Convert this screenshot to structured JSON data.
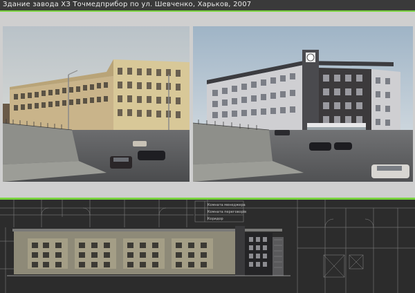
{
  "header": {
    "title": "Здание завода ХЗ Точмедприбор по ул. Шевченко, Харьков, 2007"
  },
  "photos": {
    "existing": "existing-building-photo",
    "proposal": "reconstruction-render"
  },
  "drawing": {
    "legend": [
      "Комната менеджера",
      "Комната переговорів",
      "Коридор"
    ]
  },
  "colors": {
    "accent": "#79d23e",
    "header_bg": "#3a3a3a",
    "page_bg": "#cfcfcf",
    "drawing_bg": "#2c2c2c"
  }
}
